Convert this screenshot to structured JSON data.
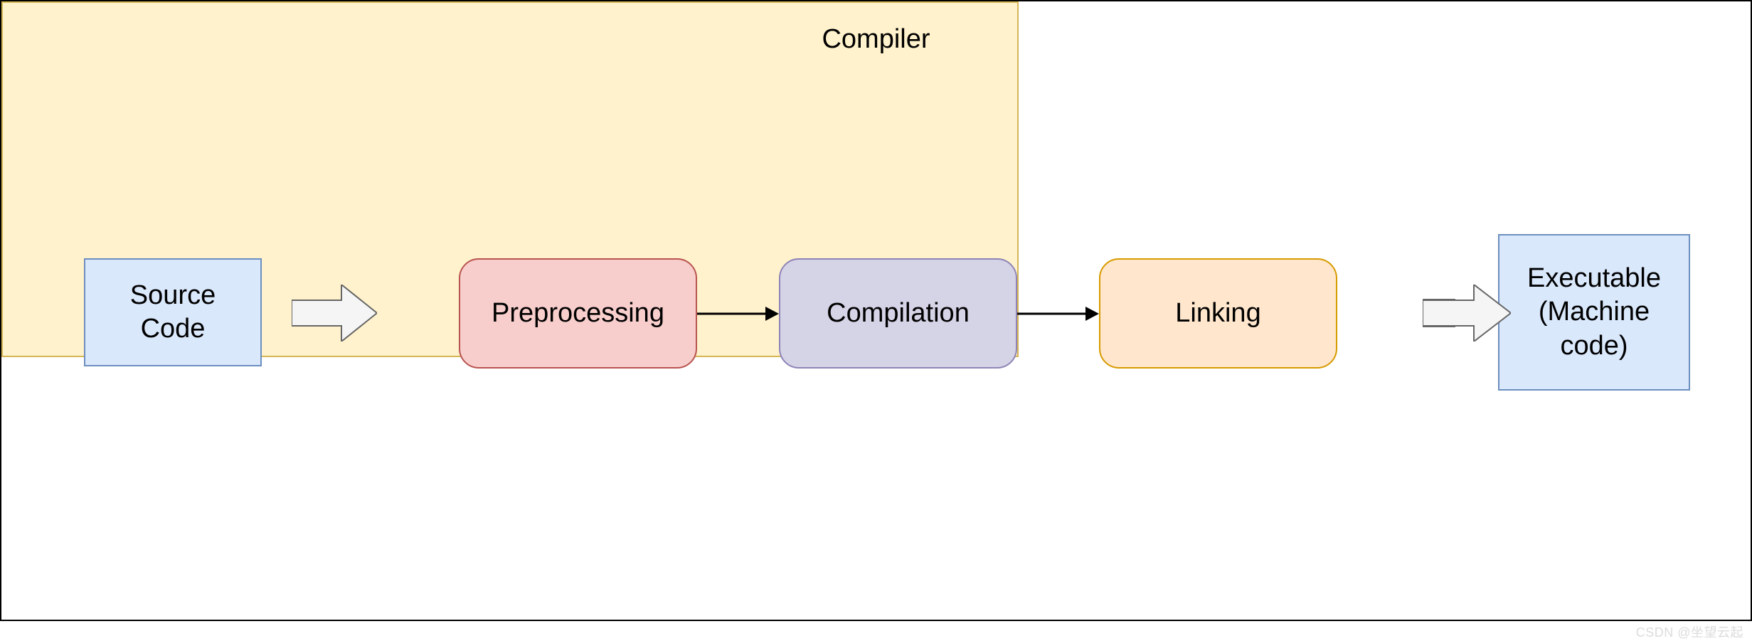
{
  "source": {
    "label": "Source\nCode"
  },
  "compiler": {
    "label": "Compiler",
    "stages": {
      "preprocessing": "Preprocessing",
      "compilation": "Compilation",
      "linking": "Linking"
    }
  },
  "executable": {
    "label": "Executable\n(Machine\ncode)"
  },
  "watermark": "CSDN @坐望云起",
  "colors": {
    "blue_fill": "#DAE8FC",
    "blue_stroke": "#6C8EBF",
    "yellow_fill": "#FFF2CC",
    "yellow_stroke": "#D6B656",
    "red_fill": "#F8CECC",
    "red_stroke": "#B85450",
    "purple_fill": "#D5D3E6",
    "purple_stroke": "#8E84B7",
    "orange_fill": "#FFE6CC",
    "orange_stroke": "#D79B00",
    "arrow_fill": "#F5F5F5",
    "arrow_stroke": "#666666"
  }
}
